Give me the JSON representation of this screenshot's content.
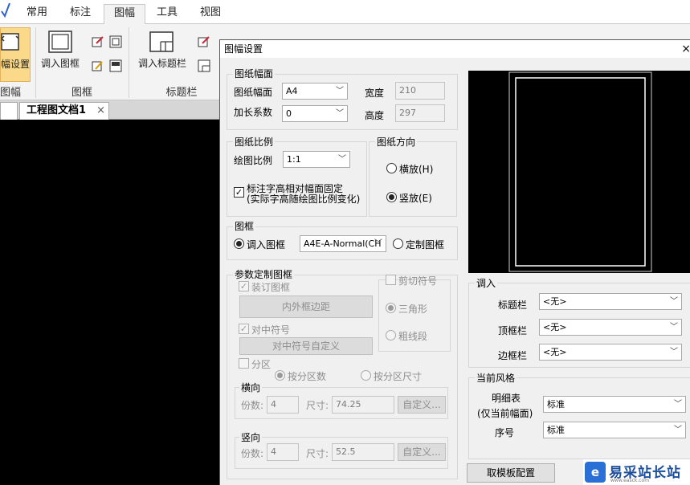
{
  "ribbon": {
    "tabs": [
      "常用",
      "标注",
      "图幅",
      "工具",
      "视图"
    ],
    "active_tab": "图幅",
    "buttons": {
      "page_setup": "幅设置",
      "load_frame": "调入图框",
      "load_title_bar": "调入标题栏"
    },
    "groups": [
      "图幅",
      "图框",
      "标题栏"
    ]
  },
  "document": {
    "tab_title": "工程图文档1",
    "close": "×"
  },
  "dialog": {
    "title": "图幅设置",
    "close": "×",
    "paper_size": {
      "group_title": "图纸幅面",
      "size_label": "图纸幅面",
      "size_value": "A4",
      "extend_label": "加长系数",
      "extend_value": "0",
      "width_label": "宽度",
      "width_value": "210",
      "height_label": "高度",
      "height_value": "297"
    },
    "scale": {
      "group_title": "图纸比例",
      "scale_label": "绘图比例",
      "scale_value": "1:1",
      "fix_text_label_line1": "标注字高相对幅面固定",
      "fix_text_label_line2": "(实际字高随绘图比例变化)",
      "fix_text_checked": "✓"
    },
    "orientation": {
      "group_title": "图纸方向",
      "landscape": "横放(H)",
      "portrait": "竖放(E)",
      "selected": "portrait"
    },
    "frame": {
      "group_title": "图框",
      "load_frame_option": "调入图框",
      "frame_value": "A4E-A-Normal(CH",
      "custom_frame_option": "定制图框"
    },
    "param_frame": {
      "group_title": "参数定制图框",
      "binding_frame": "装订图框",
      "inner_outer_button": "内外框边距",
      "center_mark": "对中符号",
      "center_mark_button": "对中符号自定义",
      "check_mark": "✓",
      "cut_mark_group": "剪切符号",
      "triangle": "三角形",
      "thick_line": "粗线段",
      "zone": "分区",
      "by_count": "按分区数",
      "by_size": "按分区尺寸",
      "horizontal": {
        "title": "横向",
        "count_label": "份数:",
        "count_value": "4",
        "size_label": "尺寸:",
        "size_value": "74.25",
        "custom_button": "自定义..."
      },
      "vertical": {
        "title": "竖向",
        "count_label": "份数:",
        "count_value": "4",
        "size_label": "尺寸:",
        "size_value": "52.5",
        "custom_button": "自定义..."
      }
    },
    "load": {
      "group_title": "调入",
      "title_bar_label": "标题栏",
      "title_bar_value": "<无>",
      "top_bar_label": "顶框栏",
      "top_bar_value": "<无>",
      "side_bar_label": "边框栏",
      "side_bar_value": "<无>"
    },
    "style": {
      "group_title": "当前风格",
      "detail_label_line1": "明细表",
      "detail_label_line2": "(仅当前幅面)",
      "detail_value": "标准",
      "sequence_label": "序号",
      "sequence_value": "标准"
    },
    "template_button": "取模板配置"
  },
  "watermark": {
    "logo": "e",
    "text": "易采站长站",
    "sub": "www.easck.com"
  },
  "colors": {
    "ribbon_active_button": "#fbd98a",
    "dialog_bg": "#f0f0f0",
    "preview_bg": "#000000"
  }
}
